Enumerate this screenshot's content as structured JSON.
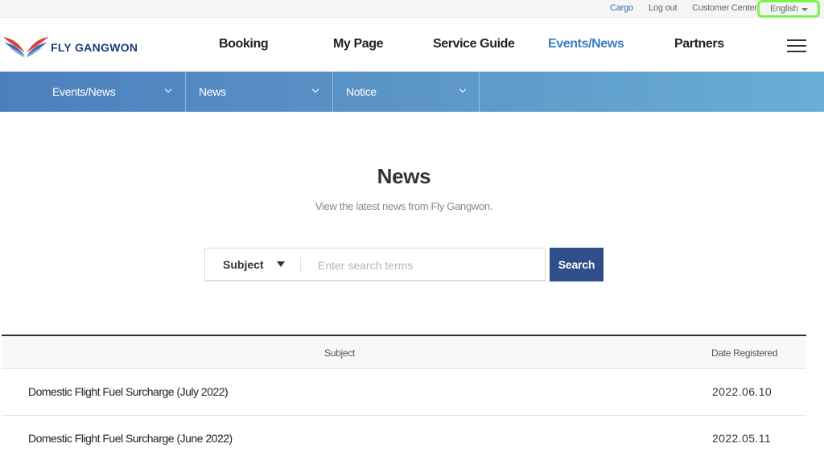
{
  "utility": {
    "cargo": "Cargo",
    "logout": "Log out",
    "customer_center": "Customer Center",
    "language": "English"
  },
  "header": {
    "logo_text": "FLY GANGWON",
    "logo_icon": "wings-logo-icon",
    "nav": {
      "booking": "Booking",
      "my_page": "My Page",
      "service_guide": "Service Guide",
      "events_news": "Events/News",
      "partners": "Partners"
    },
    "menu_icon": "hamburger-menu-icon"
  },
  "subnav": {
    "items": [
      {
        "label": "Events/News"
      },
      {
        "label": "News"
      },
      {
        "label": "Notice"
      }
    ]
  },
  "main": {
    "title": "News",
    "subtitle": "View the latest news from Fly Gangwon."
  },
  "search": {
    "select_value": "Subject",
    "placeholder": "Enter search terms",
    "button_label": "Search"
  },
  "table": {
    "headers": {
      "subject": "Subject",
      "date": "Date Registered"
    },
    "rows": [
      {
        "subject": "Domestic Flight Fuel Surcharge (July 2022)",
        "date": "2022.06.10"
      },
      {
        "subject": "Domestic Flight Fuel Surcharge (June 2022)",
        "date": "2022.05.11"
      }
    ]
  },
  "colors": {
    "accent_blue": "#3d7cc4",
    "button_navy": "#2e4f8a",
    "highlight_green": "#7cf54a",
    "logo_red": "#d6453d"
  }
}
